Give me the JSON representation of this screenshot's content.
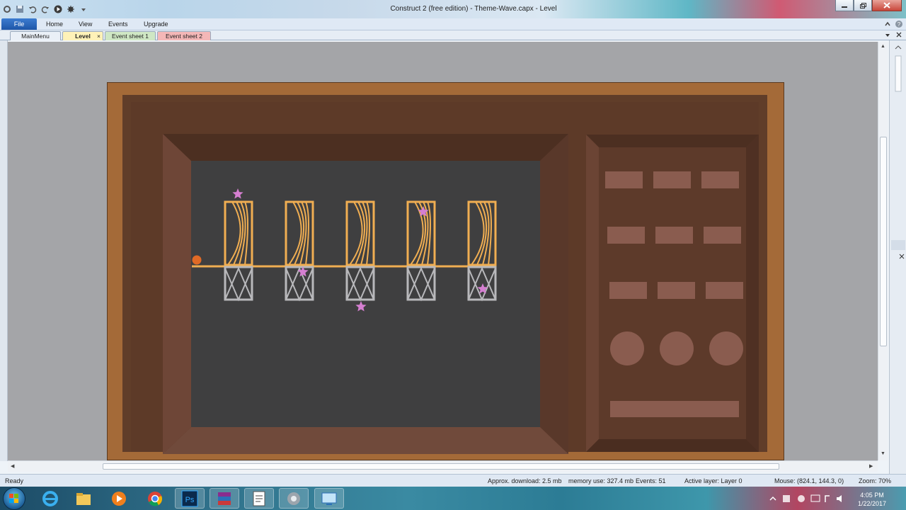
{
  "window": {
    "title": "Construct 2  (free edition) - Theme-Wave.capx - Level"
  },
  "ribbon": {
    "file_label": "File",
    "menus": [
      "Home",
      "View",
      "Events",
      "Upgrade"
    ]
  },
  "tabs": {
    "main_menu": "MainMenu",
    "level": "Level",
    "level_close": "×",
    "event_sheet_1": "Event sheet 1",
    "event_sheet_2": "Event sheet 2"
  },
  "layout": {
    "switches": 5,
    "panel_buttons_rows": 3,
    "panel_buttons_per_row": 3,
    "panel_round_buttons": 3,
    "colors": {
      "frame_outer": "#a46a38",
      "frame_inner": "#5d3a28",
      "screen": "#3f3f40",
      "wire_on": "#f0ae52",
      "wire_off": "#b8b8bb",
      "star": "#d57fd1",
      "ball": "#e06a26",
      "panel_button": "#8a5c4f"
    }
  },
  "status": {
    "ready": "Ready",
    "download": "Approx. download: 2.5 mb",
    "memory": "memory use: 327.4 mb",
    "events": "Events: 51",
    "layer": "Active layer: Layer 0",
    "mouse": "Mouse: (824.1, 144.3, 0)",
    "zoom": "Zoom: 70%"
  },
  "taskbar": {
    "time": "4:05 PM",
    "date": "1/22/2017",
    "apps": [
      "internet-explorer",
      "file-explorer",
      "media-player",
      "chrome",
      "photoshop",
      "winrar",
      "notepad",
      "construct",
      "remote-desktop"
    ],
    "photoshop_label": "Ps"
  }
}
